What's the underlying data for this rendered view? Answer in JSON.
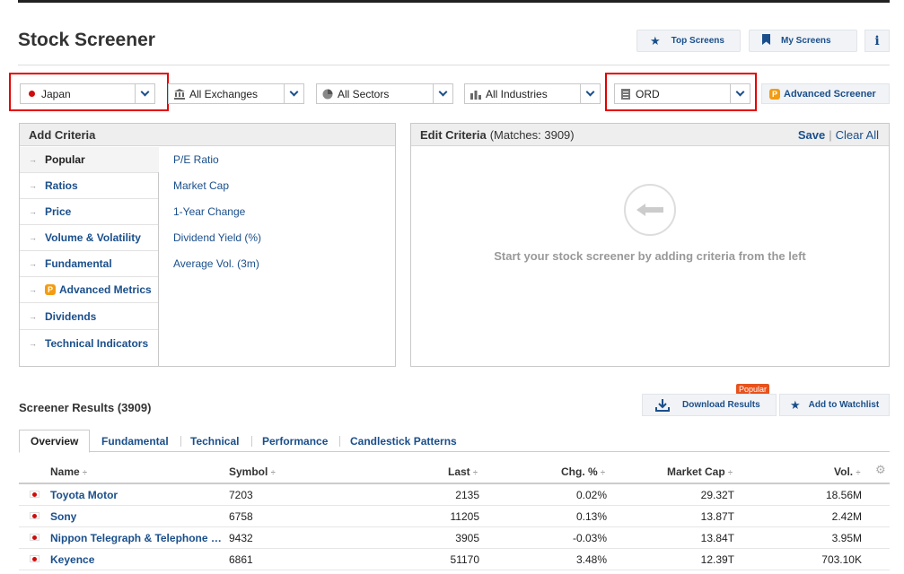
{
  "page": {
    "title": "Stock Screener"
  },
  "header": {
    "top_screens": "Top Screens",
    "my_screens": "My Screens",
    "info": "i"
  },
  "filters": {
    "country": "Japan",
    "exchange": "All Exchanges",
    "sector": "All Sectors",
    "industry": "All Industries",
    "equity_type": "ORD",
    "advanced": "Advanced Screener"
  },
  "add_criteria": {
    "title": "Add Criteria",
    "categories": [
      "Popular",
      "Ratios",
      "Price",
      "Volume & Volatility",
      "Fundamental",
      "Advanced Metrics",
      "Dividends",
      "Technical Indicators"
    ],
    "criteria": [
      "P/E Ratio",
      "Market Cap",
      "1-Year Change",
      "Dividend Yield (%)",
      "Average Vol. (3m)"
    ]
  },
  "edit_criteria": {
    "title": "Edit Criteria",
    "matches": "(Matches: 3909)",
    "save": "Save",
    "sep": "|",
    "clear": "Clear All",
    "hint": "Start your stock screener by adding criteria from the left"
  },
  "results": {
    "title": "Screener Results (3909)",
    "popular_badge": "Popular",
    "download": "Download Results",
    "watchlist": "Add to Watchlist",
    "tabs": [
      "Overview",
      "Fundamental",
      "Technical",
      "Performance",
      "Candlestick Patterns"
    ],
    "columns": [
      "Name",
      "Symbol",
      "Last",
      "Chg. %",
      "Market Cap",
      "Vol."
    ],
    "sort_glyph": "÷",
    "rows": [
      {
        "name": "Toyota Motor",
        "symbol": "7203",
        "last": "2135",
        "chg": "0.02%",
        "cap": "29.32T",
        "vol": "18.56M"
      },
      {
        "name": "Sony",
        "symbol": "6758",
        "last": "11205",
        "chg": "0.13%",
        "cap": "13.87T",
        "vol": "2.42M"
      },
      {
        "name": "Nippon Telegraph & Telephone Corp",
        "symbol": "9432",
        "last": "3905",
        "chg": "-0.03%",
        "cap": "13.84T",
        "vol": "3.95M"
      },
      {
        "name": "Keyence",
        "symbol": "6861",
        "last": "51170",
        "chg": "3.48%",
        "cap": "12.39T",
        "vol": "703.10K"
      }
    ]
  },
  "colors": {
    "link": "#1a4f8b",
    "highlight": "#e50000",
    "badge": "#e8521c",
    "premium": "#f39c12"
  },
  "icons": [
    "star-icon",
    "bookmark-icon",
    "info-icon",
    "flag-japan-icon",
    "bank-icon",
    "pie-chart-icon",
    "bar-chart-icon",
    "document-icon",
    "chevron-down-icon",
    "premium-p-icon",
    "back-arrow-icon",
    "download-icon",
    "settings-icon"
  ]
}
